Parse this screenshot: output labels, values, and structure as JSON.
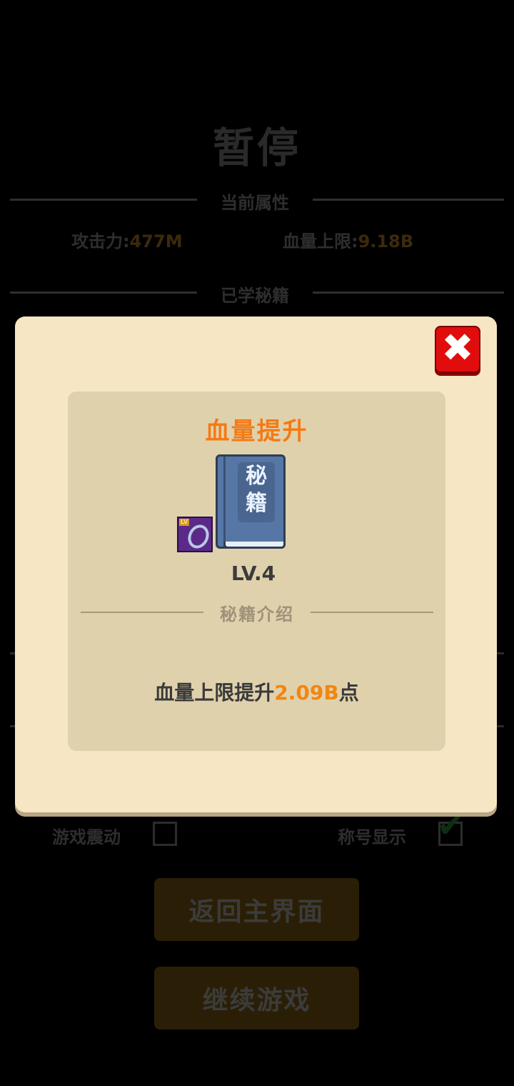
{
  "pause_screen": {
    "title": "暂停",
    "attributes_header": "当前属性",
    "attack_label": "攻击力:",
    "attack_value": "477M",
    "hp_label": "血量上限:",
    "hp_value": "9.18B",
    "learned_header": "已学秘籍",
    "vibration_label": "游戏震动",
    "vibration_checked": false,
    "title_display_label": "称号显示",
    "title_display_checked": true,
    "return_button": "返回主界面",
    "continue_button": "继续游戏"
  },
  "modal": {
    "skill_name": "血量提升",
    "book_glyph_1": "秘",
    "book_glyph_2": "籍",
    "level": "LV.4",
    "intro_header": "秘籍介绍",
    "desc_prefix": "血量上限提升",
    "desc_value": "2.09B",
    "desc_suffix": "点",
    "close_icon": "close-x-icon"
  },
  "colors": {
    "accent_orange": "#f47a15",
    "modal_bg": "#f7e6c4",
    "card_bg": "#e0d1ad",
    "close_red": "#e10d0d"
  }
}
